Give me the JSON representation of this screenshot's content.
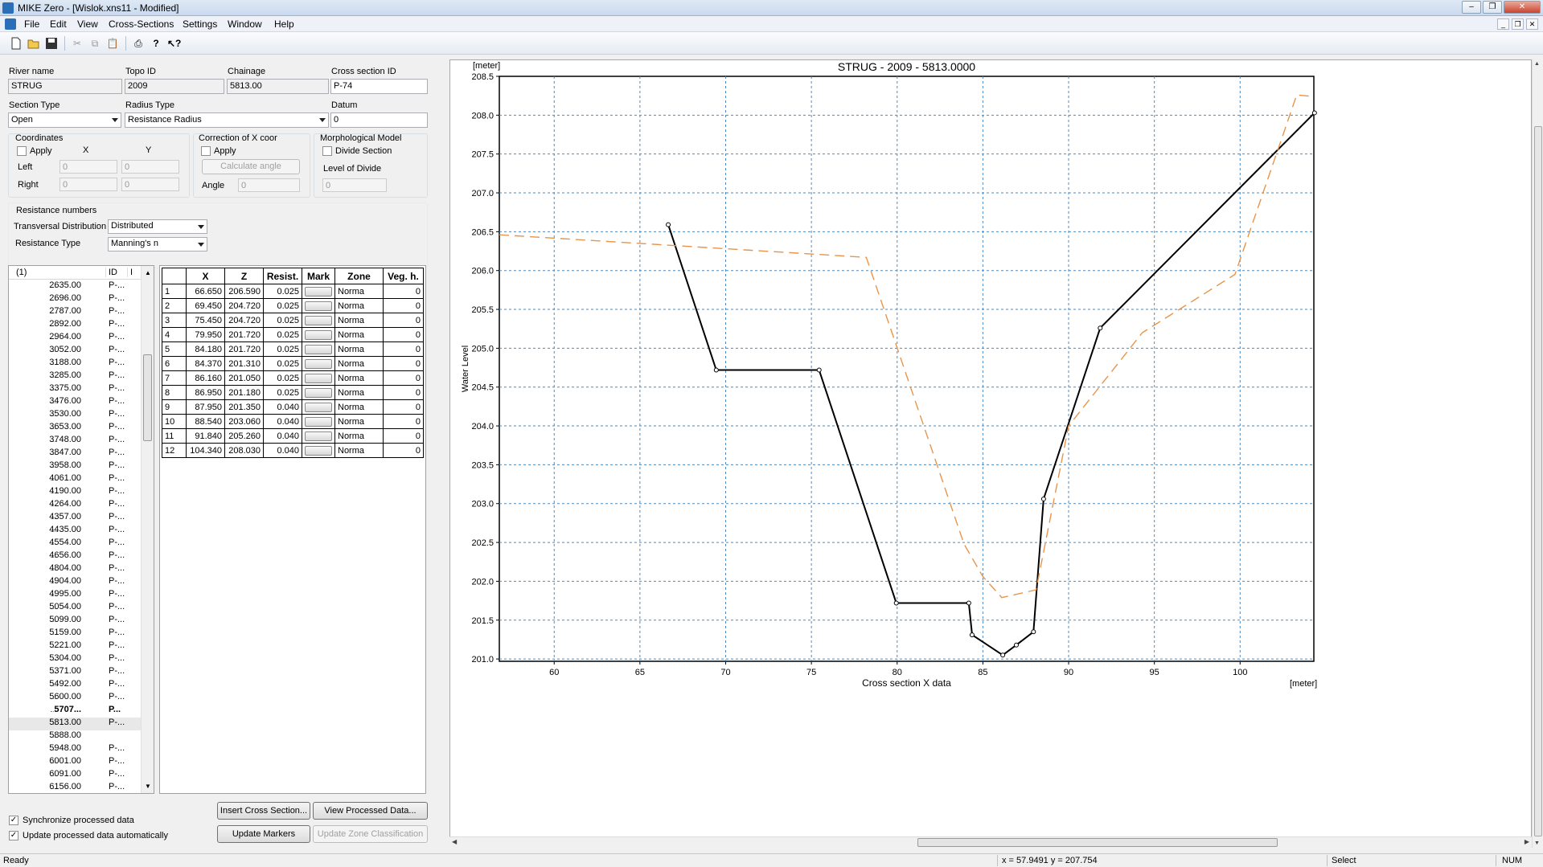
{
  "window": {
    "title": "MIKE Zero - [Wislok.xns11 - Modified]"
  },
  "menu": [
    "File",
    "Edit",
    "View",
    "Cross-Sections",
    "Settings",
    "Window",
    "Help"
  ],
  "toolbar": [
    "new-icon",
    "open-icon",
    "save-icon",
    "cut-icon",
    "copy-icon",
    "paste-icon",
    "print-icon",
    "help-icon",
    "context-help-icon"
  ],
  "form": {
    "river_name_label": "River name",
    "river_name": "STRUG",
    "topo_id_label": "Topo ID",
    "topo_id": "2009",
    "chainage_label": "Chainage",
    "chainage": "5813.00",
    "cross_section_id_label": "Cross section ID",
    "cross_section_id": "P-74",
    "section_type_label": "Section Type",
    "section_type": "Open",
    "radius_type_label": "Radius Type",
    "radius_type": "Resistance Radius",
    "datum_label": "Datum",
    "datum": "0",
    "coordinates": {
      "title": "Coordinates",
      "apply": "Apply",
      "x": "X",
      "y": "Y",
      "left": "Left",
      "right": "Right",
      "left_x": "0",
      "left_y": "0",
      "right_x": "0",
      "right_y": "0"
    },
    "correction": {
      "title": "Correction of X coor",
      "apply": "Apply",
      "calc_button": "Calculate angle",
      "angle_label": "Angle",
      "angle": "0"
    },
    "morph": {
      "title": "Morphological Model",
      "divide": "Divide Section",
      "level_label": "Level of Divide",
      "level": "0"
    },
    "resistance": {
      "title": "Resistance numbers",
      "transversal_label": "Transversal Distribution",
      "transversal": "Distributed",
      "type_label": "Resistance Type",
      "type": "Manning's n"
    }
  },
  "tree": {
    "col1": "(1)",
    "col2": "ID",
    "col3": "I",
    "rows": [
      {
        "ch": "2635.00",
        "id": "P-..."
      },
      {
        "ch": "2696.00",
        "id": "P-..."
      },
      {
        "ch": "2787.00",
        "id": "P-..."
      },
      {
        "ch": "2892.00",
        "id": "P-..."
      },
      {
        "ch": "2964.00",
        "id": "P-..."
      },
      {
        "ch": "3052.00",
        "id": "P-..."
      },
      {
        "ch": "3188.00",
        "id": "P-..."
      },
      {
        "ch": "3285.00",
        "id": "P-..."
      },
      {
        "ch": "3375.00",
        "id": "P-..."
      },
      {
        "ch": "3476.00",
        "id": "P-..."
      },
      {
        "ch": "3530.00",
        "id": "P-..."
      },
      {
        "ch": "3653.00",
        "id": "P-..."
      },
      {
        "ch": "3748.00",
        "id": "P-..."
      },
      {
        "ch": "3847.00",
        "id": "P-..."
      },
      {
        "ch": "3958.00",
        "id": "P-..."
      },
      {
        "ch": "4061.00",
        "id": "P-..."
      },
      {
        "ch": "4190.00",
        "id": "P-..."
      },
      {
        "ch": "4264.00",
        "id": "P-..."
      },
      {
        "ch": "4357.00",
        "id": "P-..."
      },
      {
        "ch": "4435.00",
        "id": "P-..."
      },
      {
        "ch": "4554.00",
        "id": "P-..."
      },
      {
        "ch": "4656.00",
        "id": "P-..."
      },
      {
        "ch": "4804.00",
        "id": "P-..."
      },
      {
        "ch": "4904.00",
        "id": "P-..."
      },
      {
        "ch": "4995.00",
        "id": "P-..."
      },
      {
        "ch": "5054.00",
        "id": "P-..."
      },
      {
        "ch": "5099.00",
        "id": "P-..."
      },
      {
        "ch": "5159.00",
        "id": "P-..."
      },
      {
        "ch": "5221.00",
        "id": "P-..."
      },
      {
        "ch": "5304.00",
        "id": "P-..."
      },
      {
        "ch": "5371.00",
        "id": "P-..."
      },
      {
        "ch": "5492.00",
        "id": "P-..."
      },
      {
        "ch": "5600.00",
        "id": "P-..."
      },
      {
        "ch": "5707...",
        "id": "P...",
        "bold": true
      },
      {
        "ch": "5813.00",
        "id": "P-...",
        "selected": true
      },
      {
        "ch": "5888.00",
        "id": ""
      },
      {
        "ch": "5948.00",
        "id": "P-..."
      },
      {
        "ch": "6001.00",
        "id": "P-..."
      },
      {
        "ch": "6091.00",
        "id": "P-..."
      },
      {
        "ch": "6156.00",
        "id": "P-..."
      }
    ]
  },
  "grid": {
    "headers": [
      "",
      "X",
      "Z",
      "Resist.",
      "Mark",
      "Zone",
      "Veg. h."
    ],
    "rows": [
      [
        "1",
        "66.650",
        "206.590",
        "0.025",
        "Norma",
        "0"
      ],
      [
        "2",
        "69.450",
        "204.720",
        "0.025",
        "Norma",
        "0"
      ],
      [
        "3",
        "75.450",
        "204.720",
        "0.025",
        "Norma",
        "0"
      ],
      [
        "4",
        "79.950",
        "201.720",
        "0.025",
        "Norma",
        "0"
      ],
      [
        "5",
        "84.180",
        "201.720",
        "0.025",
        "Norma",
        "0"
      ],
      [
        "6",
        "84.370",
        "201.310",
        "0.025",
        "Norma",
        "0"
      ],
      [
        "7",
        "86.160",
        "201.050",
        "0.025",
        "Norma",
        "0"
      ],
      [
        "8",
        "86.950",
        "201.180",
        "0.025",
        "Norma",
        "0"
      ],
      [
        "9",
        "87.950",
        "201.350",
        "0.040",
        "Norma",
        "0"
      ],
      [
        "10",
        "88.540",
        "203.060",
        "0.040",
        "Norma",
        "0"
      ],
      [
        "11",
        "91.840",
        "205.260",
        "0.040",
        "Norma",
        "0"
      ],
      [
        "12",
        "104.340",
        "208.030",
        "0.040",
        "Norma",
        "0"
      ]
    ]
  },
  "options": {
    "sync": "Synchronize processed data",
    "update": "Update processed data automatically"
  },
  "buttons": {
    "insert": "Insert Cross Section...",
    "view": "View Processed Data...",
    "markers": "Update Markers",
    "zone": "Update Zone Classification"
  },
  "chart_data": {
    "type": "line",
    "title": "STRUG - 2009 - 5813.0000",
    "ylabel": "Water Level",
    "xlabel": "Cross section X data",
    "x_unit": "[meter]",
    "y_unit": "[meter]",
    "xlim": [
      56.8,
      104.3
    ],
    "ylim": [
      200.97,
      208.5
    ],
    "xticks": [
      60,
      65,
      70,
      75,
      80,
      85,
      90,
      95,
      100
    ],
    "yticks": [
      201.0,
      201.5,
      202.0,
      202.5,
      203.0,
      203.5,
      204.0,
      204.5,
      205.0,
      205.5,
      206.0,
      206.5,
      207.0,
      207.5,
      208.0,
      208.5
    ],
    "grid": true,
    "series": [
      {
        "style": "solid",
        "color": "#000000",
        "markers": true,
        "x": [
          66.65,
          69.45,
          75.45,
          79.95,
          84.18,
          84.37,
          86.16,
          86.95,
          87.95,
          88.54,
          91.84,
          104.34
        ],
        "y": [
          206.59,
          204.72,
          204.72,
          201.72,
          201.72,
          201.31,
          201.05,
          201.18,
          201.35,
          203.06,
          205.26,
          208.03
        ]
      },
      {
        "style": "dashed",
        "color": "#e8944a",
        "markers": false,
        "x": [
          56.8,
          78.2,
          83.9,
          85.0,
          86.1,
          88.1,
          90.0,
          94.3,
          99.7,
          103.3,
          104.3
        ],
        "y": [
          206.46,
          206.17,
          202.48,
          202.06,
          201.79,
          201.89,
          204.0,
          205.2,
          205.95,
          208.26,
          208.24
        ]
      }
    ]
  },
  "status": {
    "ready": "Ready",
    "coords": "x = 57.9491  y = 207.754",
    "mode": "Select",
    "num": "NUM"
  }
}
